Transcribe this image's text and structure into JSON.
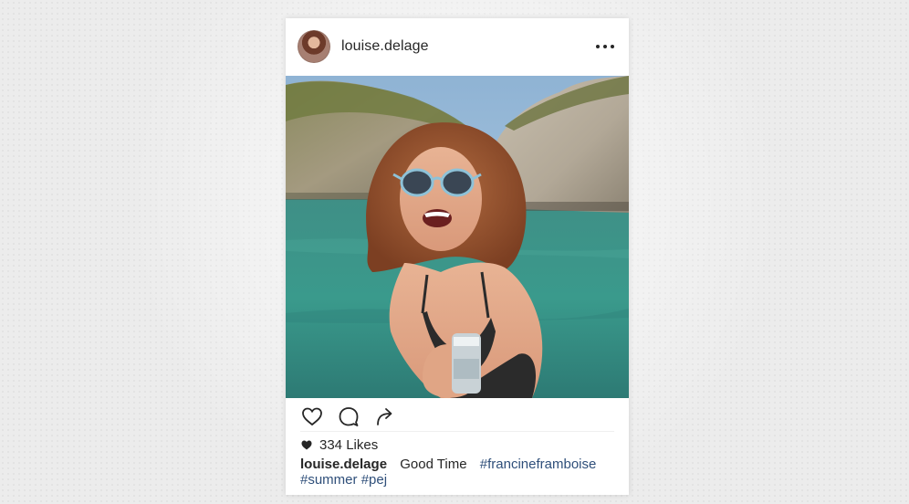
{
  "post": {
    "username": "louise.delage",
    "likes_count": "334 Likes",
    "caption": {
      "username": "louise.delage",
      "text": "Good Time",
      "hashtags": [
        "#francineframboise",
        "#summer",
        "#pej"
      ]
    }
  },
  "icons": {
    "more": "more-horizontal-icon",
    "like": "heart-outline-icon",
    "comment": "comment-bubble-icon",
    "share": "share-arrow-icon",
    "likes_heart": "heart-filled-icon"
  },
  "colors": {
    "hashtag": "#2f4f7a",
    "text": "#262626"
  }
}
